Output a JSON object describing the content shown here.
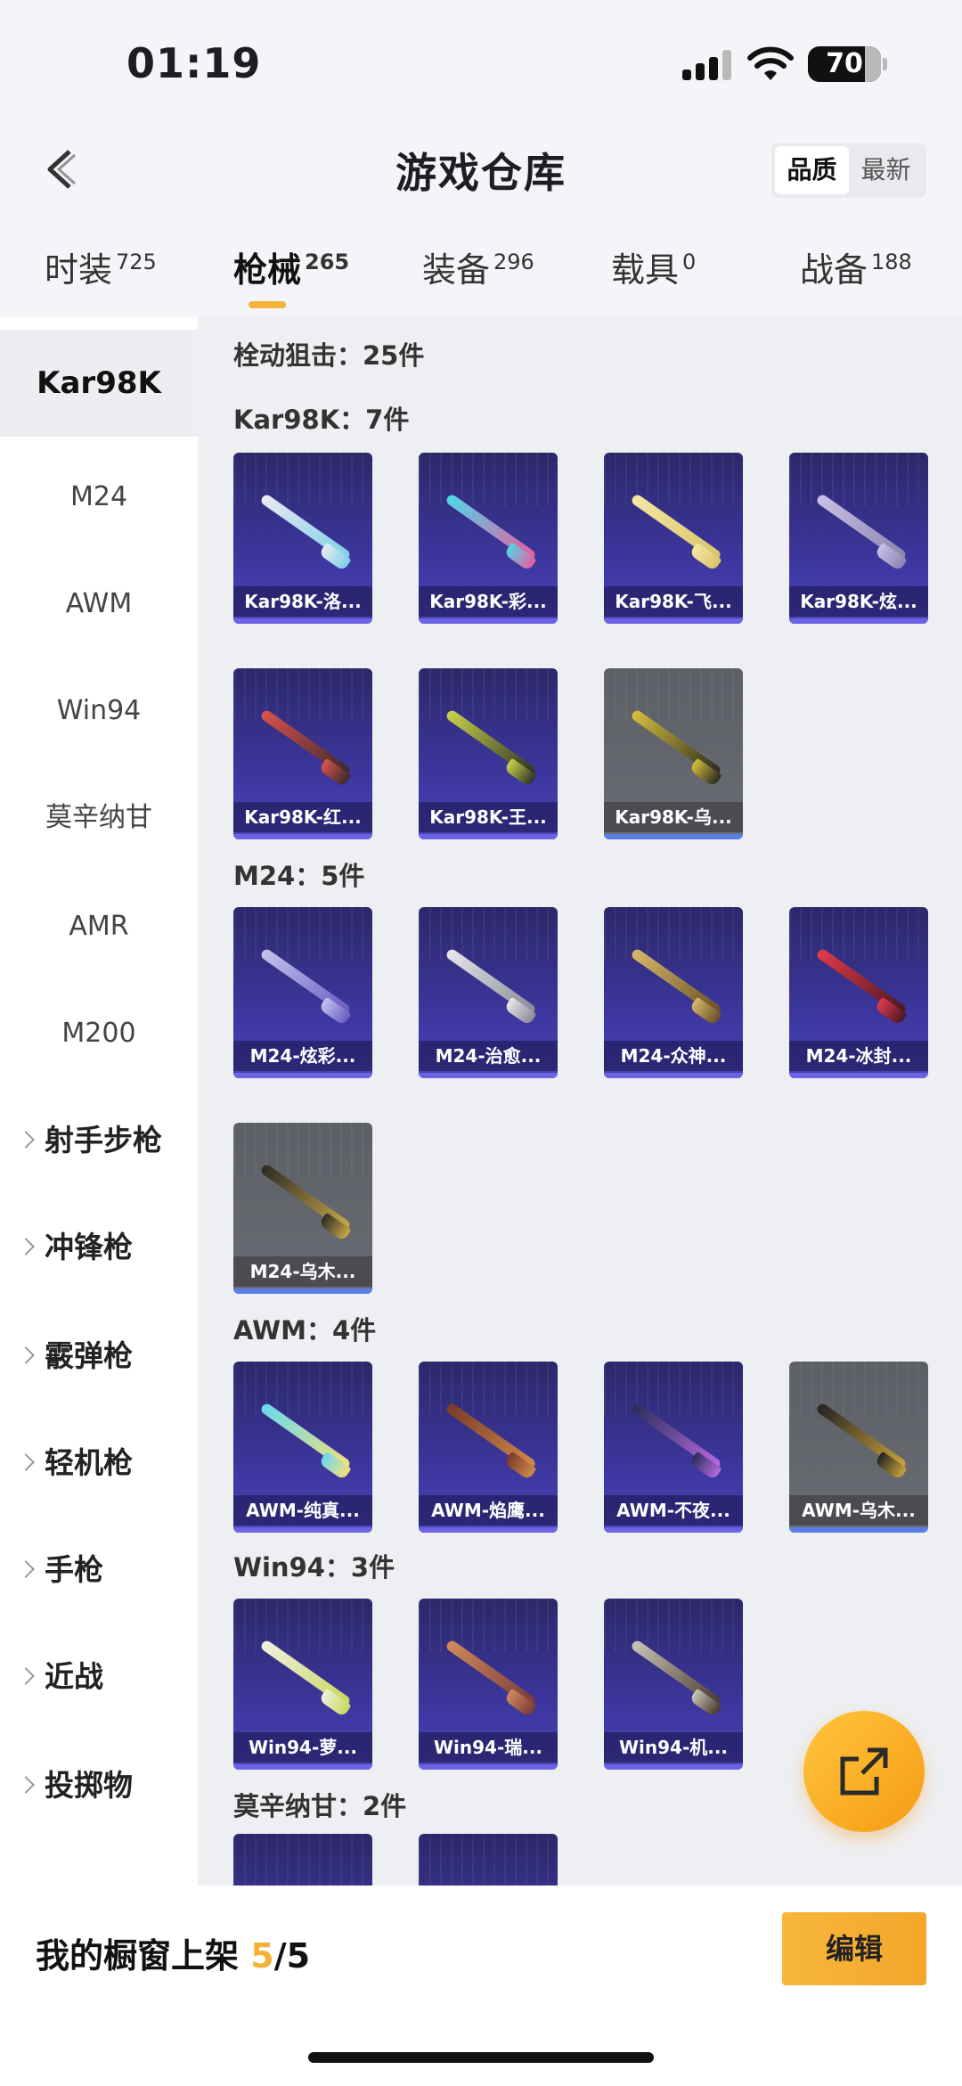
{
  "status_bar": {
    "time": "01:19",
    "battery": "70"
  },
  "header": {
    "title": "游戏仓库",
    "sort_options": [
      "品质",
      "最新"
    ]
  },
  "tabs": [
    {
      "label": "时装",
      "count": "725"
    },
    {
      "label": "枪械",
      "count": "265"
    },
    {
      "label": "装备",
      "count": "296"
    },
    {
      "label": "载具",
      "count": "0"
    },
    {
      "label": "战备",
      "count": "188"
    }
  ],
  "sidebar": {
    "items": [
      "Kar98K",
      "M24",
      "AWM",
      "Win94",
      "莫辛纳甘",
      "AMR",
      "M200"
    ],
    "groups": [
      "射手步枪",
      "冲锋枪",
      "霰弹枪",
      "轻机枪",
      "手枪",
      "近战",
      "投掷物"
    ]
  },
  "content": {
    "category_title": "栓动狙击：25件",
    "sections": [
      {
        "title": "Kar98K：7件",
        "cards": [
          "Kar98K-洛...",
          "Kar98K-彩...",
          "Kar98K-飞...",
          "Kar98K-炫...",
          "Kar98K-红...",
          "Kar98K-王...",
          "Kar98K-乌..."
        ]
      },
      {
        "title": "M24：5件",
        "cards": [
          "M24-炫彩...",
          "M24-治愈...",
          "M24-众神...",
          "M24-冰封...",
          "M24-乌木..."
        ]
      },
      {
        "title": "AWM：4件",
        "cards": [
          "AWM-纯真...",
          "AWM-焰鹰...",
          "AWM-不夜...",
          "AWM-乌木..."
        ]
      },
      {
        "title": "Win94：3件",
        "cards": [
          "Win94-萝...",
          "Win94-瑞...",
          "Win94-机..."
        ]
      },
      {
        "title": "莫辛纳甘：2件",
        "cards": []
      }
    ]
  },
  "bottom_bar": {
    "showcase_label": "我的橱窗上架",
    "showcase_current": "5",
    "showcase_total": "/5",
    "edit_label": "编辑"
  },
  "colors": {
    "accent": "#f3b234",
    "card_purple": "#3d37a0",
    "card_gray": "#65676e"
  }
}
